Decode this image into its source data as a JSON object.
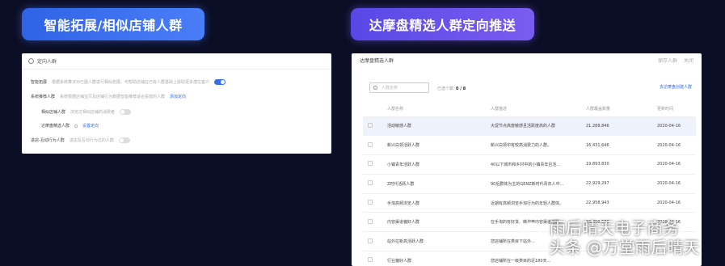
{
  "left_pill": {
    "label": "智能拓展/相似店铺人群"
  },
  "right_pill": {
    "label": "达摩盘精选人群定向推送"
  },
  "left_panel": {
    "title": "定向人群",
    "rows": [
      {
        "label": "智能拓展",
        "desc": "根据系统算法对已圈人群进行相似拓展，可帮助店铺在已有人群基础上获取更多潜在客户",
        "toggle": "on"
      },
      {
        "label": "系统推荐人群",
        "desc": "系统根据店铺宝贝及店铺行为数据智能推荐适合投放的人群",
        "link": "添加定向"
      },
      {
        "label": "相似店铺人群",
        "desc": "浏览过相似店铺的消费者",
        "toggle": "off"
      },
      {
        "label": "达摩盘精选人群",
        "link": "设置定向"
      },
      {
        "label": "进店-互动行为人群",
        "desc": "进店及互动行为过的人群",
        "toggle": "off"
      }
    ]
  },
  "right_panel": {
    "title": "达摩盘精选人群",
    "head_right": [
      "保存人群",
      "关闭"
    ],
    "search_placeholder": "人群名称",
    "selected_label": "已选个数",
    "selected_count": "0 / 8",
    "link": "去达摩盘创建人群",
    "columns": [
      "人群名称",
      "人群描述",
      "人群覆盖数量",
      "更新时间"
    ],
    "rows": [
      {
        "name": "活动敏感人群",
        "desc": "大促节点高度敏感且活跃度高的人群",
        "count": "21,288,846",
        "date": "2020-04-16"
      },
      {
        "name": "新兴白领活跃人群",
        "desc": "新兴白领中有较高消费力的人群。",
        "count": "16,431,646",
        "date": "2020-04-16"
      },
      {
        "name": "小镇青年活跃人群",
        "desc": "40以下城市和乡村中的小镇青年且活...",
        "count": "19,893,830",
        "date": "2020-04-16"
      },
      {
        "name": "Z时代活跃人群",
        "desc": "90后群体为主的GENZ新时代青年人中...",
        "count": "22,929,297",
        "date": "2020-04-16"
      },
      {
        "name": "手淘高频浏览人群",
        "desc": "近期有高频浏览手淘行为的年轻人群体。",
        "count": "22,958,943",
        "date": "2020-04-16"
      },
      {
        "name": "内容渠道偏好人群",
        "desc": "在手淘的有好货、微淘等内容渠道活跃...",
        "count": "15,890,586",
        "date": "2020-04-16"
      },
      {
        "name": "站外拉新高活跃人群",
        "desc": "您店铺所在类目下站外...",
        "count": "",
        "date": ""
      },
      {
        "name": "行业偏好人群",
        "desc": "您店铺所在一级类目的近180天...",
        "count": "",
        "date": ""
      }
    ]
  },
  "watermark": {
    "line1": "雨后晴天电子商务",
    "line2": "头条 @万堂雨后晴天"
  }
}
